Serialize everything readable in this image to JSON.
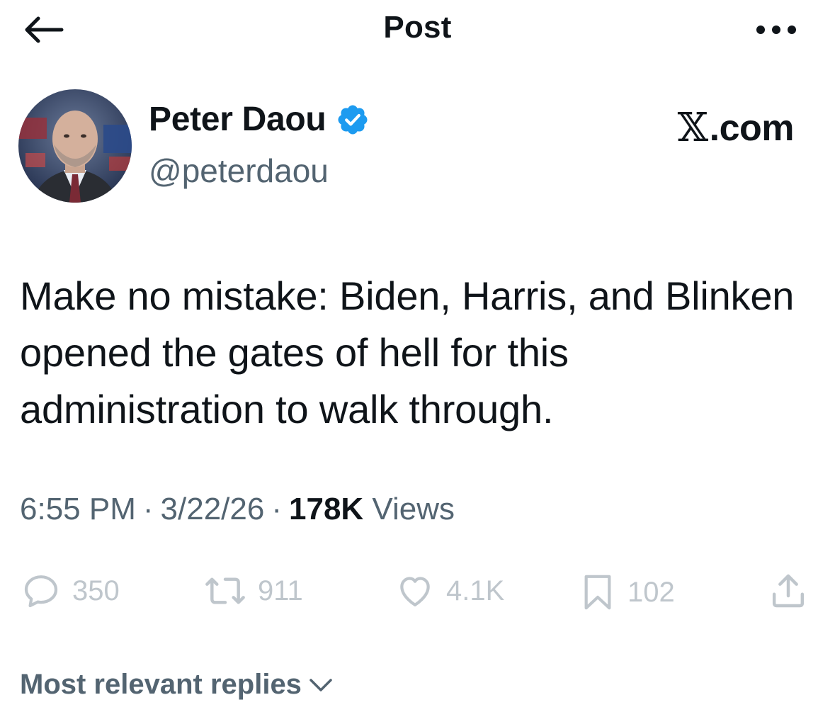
{
  "header": {
    "title": "Post",
    "back_icon": "arrow-left-icon",
    "more_icon": "more-horizontal-icon"
  },
  "author": {
    "display_name": "Peter Daou",
    "handle": "@peterdaou",
    "verified": true,
    "verified_color": "#1d9bf0"
  },
  "brand": {
    "glyph": "𝕏",
    "text": ".com"
  },
  "post": {
    "text": "Make no mistake: Biden, Harris, and Blinken opened the gates of hell for this administration to walk through.",
    "time": "6:55 PM",
    "separator": "·",
    "date": "3/22/26",
    "views_count": "178K",
    "views_label": "Views"
  },
  "actions": {
    "replies": "350",
    "reposts": "911",
    "likes": "4.1K",
    "bookmarks": "102",
    "icon_color": "#bfc6cc"
  },
  "replies_sort": {
    "label": "Most relevant replies"
  },
  "colors": {
    "text_primary": "#0f1419",
    "text_secondary": "#536471"
  }
}
